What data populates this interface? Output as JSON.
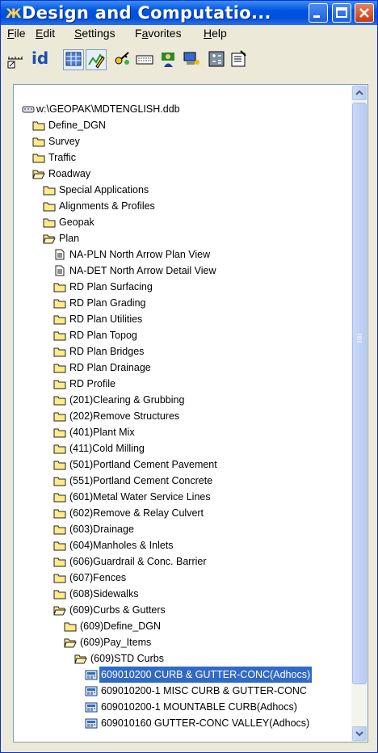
{
  "window": {
    "title": "Design and Computatio..."
  },
  "menu": [
    {
      "label": "File",
      "mnemonic": "F"
    },
    {
      "label": "Edit",
      "mnemonic": "E"
    },
    {
      "label": "Settings",
      "mnemonic": "S"
    },
    {
      "label": "Favorites",
      "mnemonic": "a"
    },
    {
      "label": "Help",
      "mnemonic": "H"
    }
  ],
  "toolbar": {
    "id_label": "id",
    "items": [
      "place-element-icon",
      "id-icon",
      "grid-view-icon",
      "pencil-icon",
      "key-icon",
      "keyboard-icon",
      "user-icon",
      "computer-icon",
      "calculator-icon",
      "properties-icon"
    ]
  },
  "tree": [
    {
      "label": "w:\\GEOPAK\\MDTENGLISH.ddb",
      "level": 0,
      "icon": "database-icon"
    },
    {
      "label": "Define_DGN",
      "level": 1,
      "icon": "folder-icon"
    },
    {
      "label": "Survey",
      "level": 1,
      "icon": "folder-icon"
    },
    {
      "label": "Traffic",
      "level": 1,
      "icon": "folder-icon"
    },
    {
      "label": "Roadway",
      "level": 1,
      "icon": "folder-open-icon"
    },
    {
      "label": "Special Applications",
      "level": 2,
      "icon": "folder-icon"
    },
    {
      "label": "Alignments & Profiles",
      "level": 2,
      "icon": "folder-icon"
    },
    {
      "label": "Geopak",
      "level": 2,
      "icon": "folder-icon"
    },
    {
      "label": "Plan",
      "level": 2,
      "icon": "folder-open-icon"
    },
    {
      "label": "NA-PLN North Arrow Plan View",
      "level": 3,
      "icon": "document-icon"
    },
    {
      "label": "NA-DET North Arrow Detail View",
      "level": 3,
      "icon": "document-icon"
    },
    {
      "label": "RD Plan Surfacing",
      "level": 3,
      "icon": "folder-icon"
    },
    {
      "label": "RD Plan Grading",
      "level": 3,
      "icon": "folder-icon"
    },
    {
      "label": "RD Plan Utilities",
      "level": 3,
      "icon": "folder-icon"
    },
    {
      "label": "RD Plan Topog",
      "level": 3,
      "icon": "folder-icon"
    },
    {
      "label": "RD Plan Bridges",
      "level": 3,
      "icon": "folder-icon"
    },
    {
      "label": "RD Plan Drainage",
      "level": 3,
      "icon": "folder-icon"
    },
    {
      "label": "RD Profile",
      "level": 3,
      "icon": "folder-icon"
    },
    {
      "label": "(201)Clearing & Grubbing",
      "level": 3,
      "icon": "folder-icon"
    },
    {
      "label": "(202)Remove Structures",
      "level": 3,
      "icon": "folder-icon"
    },
    {
      "label": "(401)Plant Mix",
      "level": 3,
      "icon": "folder-icon"
    },
    {
      "label": "(411)Cold Milling",
      "level": 3,
      "icon": "folder-icon"
    },
    {
      "label": "(501)Portland Cement Pavement",
      "level": 3,
      "icon": "folder-icon"
    },
    {
      "label": "(551)Portland Cement Concrete",
      "level": 3,
      "icon": "folder-icon"
    },
    {
      "label": "(601)Metal Water Service Lines",
      "level": 3,
      "icon": "folder-icon"
    },
    {
      "label": "(602)Remove & Relay Culvert",
      "level": 3,
      "icon": "folder-icon"
    },
    {
      "label": "(603)Drainage",
      "level": 3,
      "icon": "folder-icon"
    },
    {
      "label": "(604)Manholes & Inlets",
      "level": 3,
      "icon": "folder-icon"
    },
    {
      "label": "(606)Guardrail & Conc. Barrier",
      "level": 3,
      "icon": "folder-icon"
    },
    {
      "label": "(607)Fences",
      "level": 3,
      "icon": "folder-icon"
    },
    {
      "label": "(608)Sidewalks",
      "level": 3,
      "icon": "folder-icon"
    },
    {
      "label": "(609)Curbs & Gutters",
      "level": 3,
      "icon": "folder-open-icon"
    },
    {
      "label": "(609)Define_DGN",
      "level": 4,
      "icon": "folder-icon"
    },
    {
      "label": "(609)Pay_Items",
      "level": 4,
      "icon": "folder-open-icon"
    },
    {
      "label": "(609)STD Curbs",
      "level": 5,
      "icon": "folder-open-icon"
    },
    {
      "label": "609010200 CURB & GUTTER-CONC(Adhocs)",
      "level": 6,
      "icon": "pay-item-icon",
      "selected": true
    },
    {
      "label": "609010200-1 MISC CURB & GUTTER-CONC",
      "level": 6,
      "icon": "pay-item-icon"
    },
    {
      "label": "609010200-1 MOUNTABLE CURB(Adhocs)",
      "level": 6,
      "icon": "pay-item-icon"
    },
    {
      "label": "609010160 GUTTER-CONC VALLEY(Adhocs)",
      "level": 6,
      "icon": "pay-item-icon"
    }
  ],
  "colors": {
    "titlebar": "#0054e3",
    "selection": "#316ac5",
    "folder": "#ffe98a"
  }
}
